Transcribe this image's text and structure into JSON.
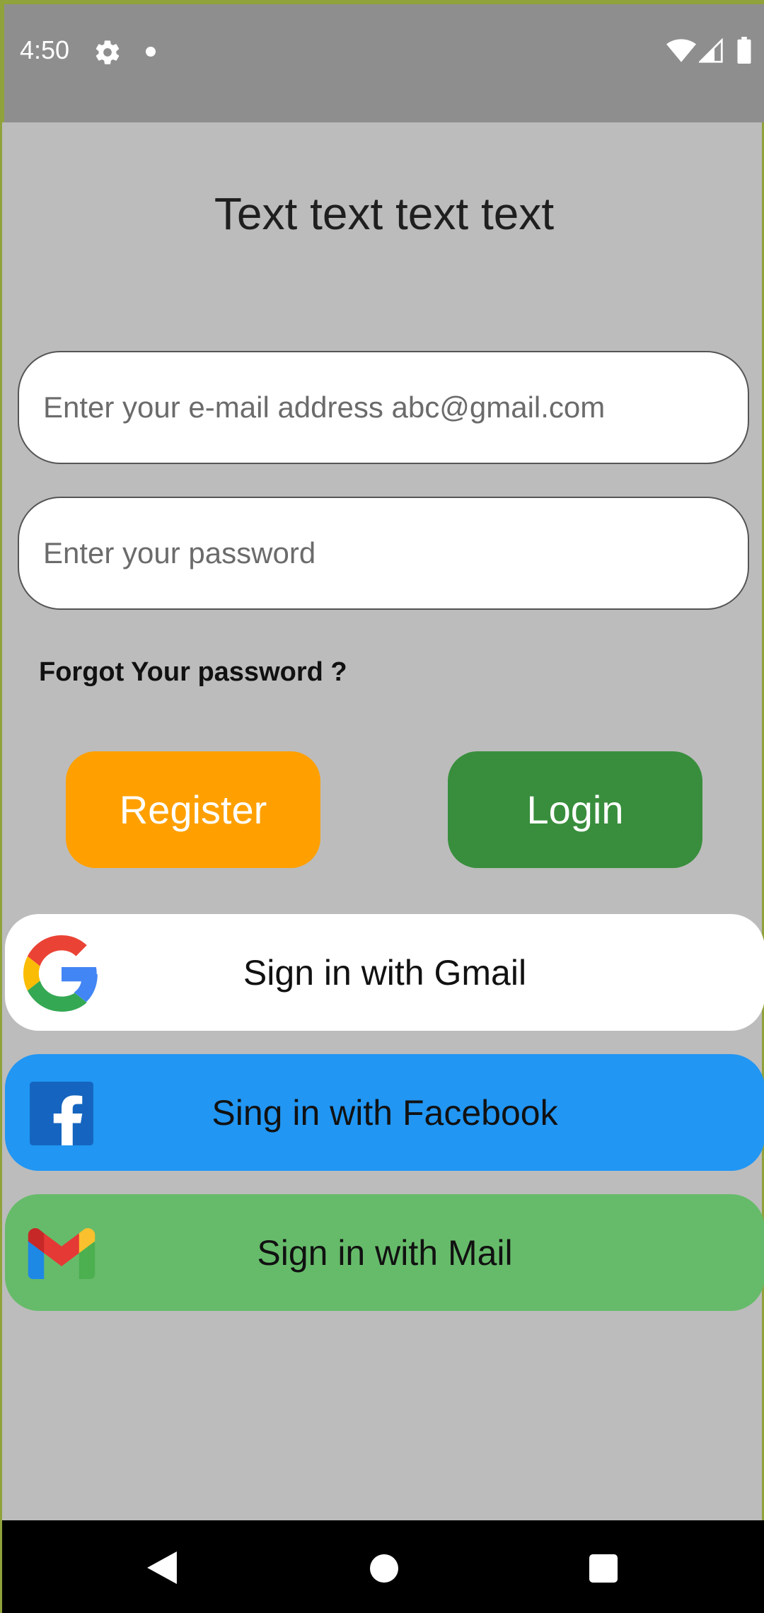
{
  "status_bar": {
    "time": "4:50",
    "icons": [
      "gear-icon",
      "dot-icon",
      "wifi-icon",
      "signal-icon",
      "battery-icon"
    ]
  },
  "title": "Text text text text",
  "email_input": {
    "placeholder": "Enter your e-mail address abc@gmail.com",
    "value": ""
  },
  "password_input": {
    "placeholder": "Enter your password",
    "value": ""
  },
  "forgot_password": "Forgot Your password  ?",
  "buttons": {
    "register": "Register",
    "login": "Login"
  },
  "social": {
    "gmail": "Sign in with Gmail",
    "facebook": "Sing in with Facebook",
    "mail": "Sign in with Mail"
  },
  "colors": {
    "background": "#bcbcbc",
    "status_bar": "#8e8e8e",
    "register": "#ffa000",
    "login": "#388e3c",
    "gmail_button": "#ffffff",
    "facebook_button": "#2196f3",
    "mail_button": "#66bb6a"
  },
  "nav_bar": {
    "icons": [
      "back-icon",
      "home-icon",
      "recents-icon"
    ]
  }
}
